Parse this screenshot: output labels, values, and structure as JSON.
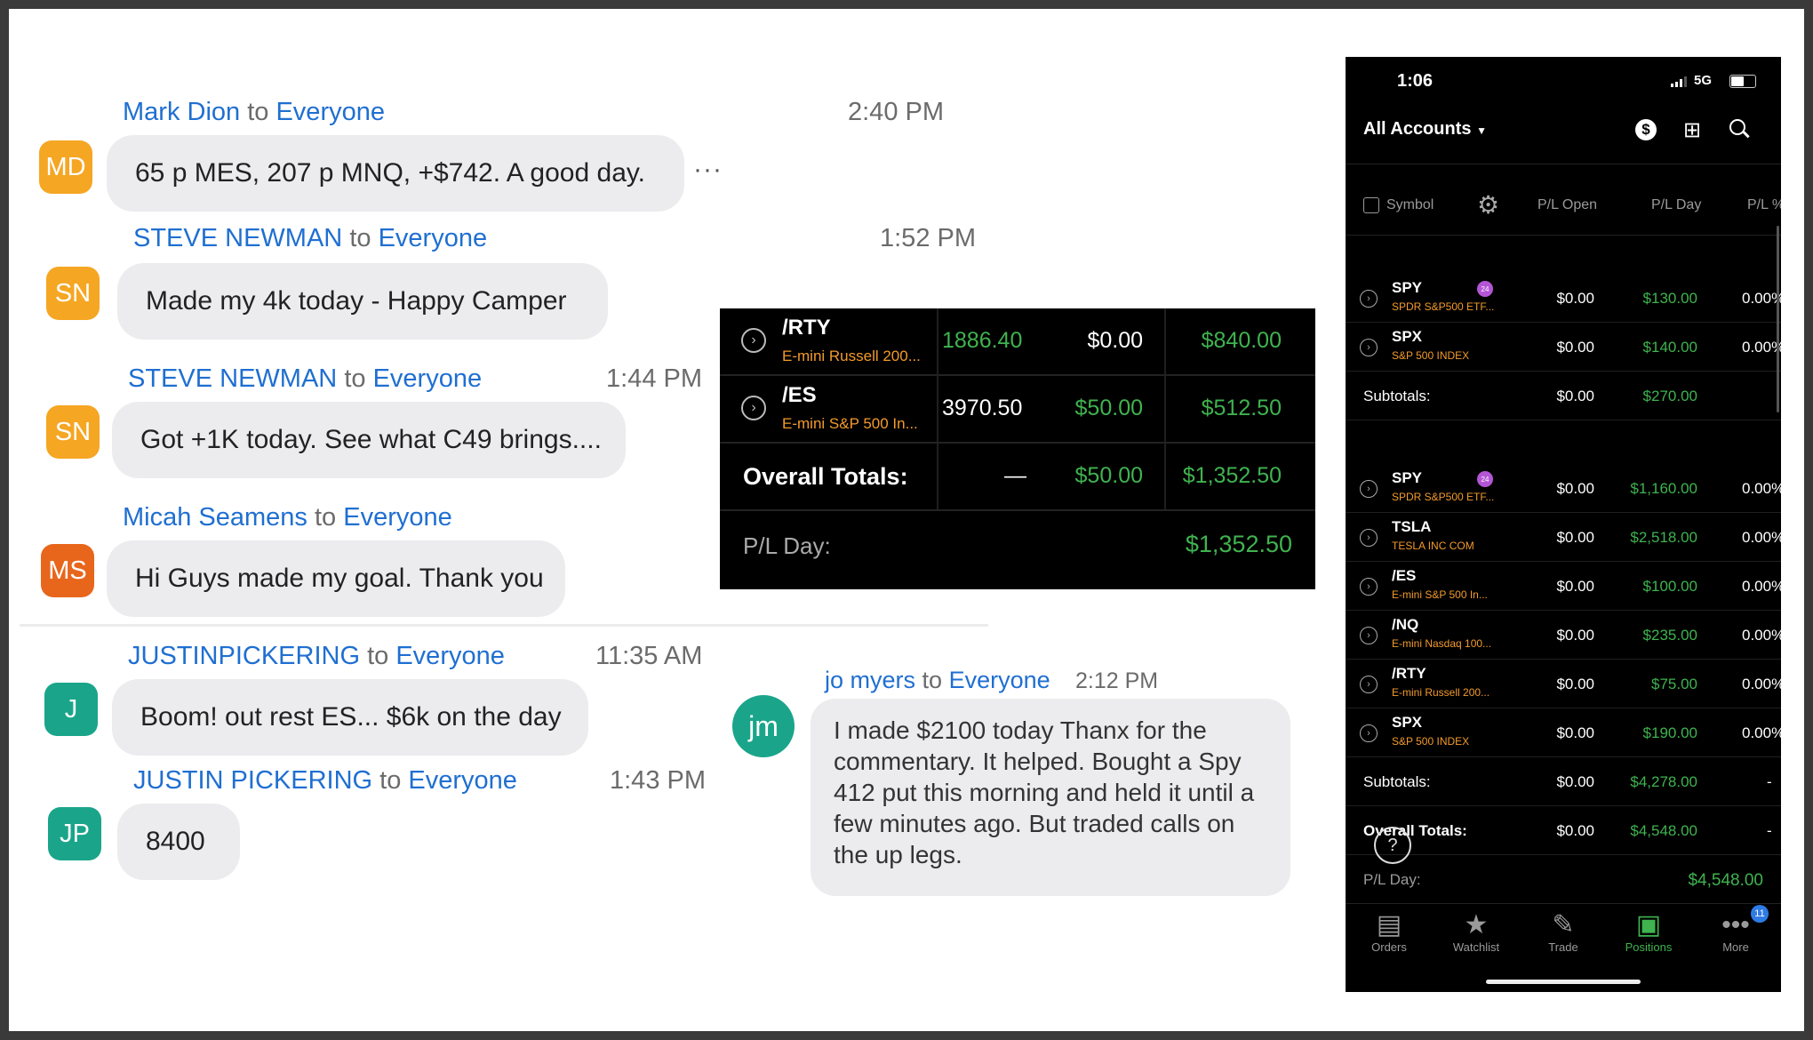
{
  "chat": [
    {
      "initials": "MD",
      "name": "Mark Dion",
      "to": "to",
      "audience": "Everyone",
      "time": "2:40 PM",
      "text": "65 p MES, 207 p MNQ, +$742.    A good day.",
      "color": "#f5a623"
    },
    {
      "initials": "SN",
      "name": "STEVE NEWMAN",
      "to": "to",
      "audience": "Everyone",
      "time": "1:52 PM",
      "text": "Made my 4k today - Happy Camper",
      "color": "#f5a623"
    },
    {
      "initials": "SN",
      "name": "STEVE NEWMAN",
      "to": "to",
      "audience": "Everyone",
      "time": "1:44 PM",
      "text": "Got +1K today. See what C49 brings....",
      "color": "#f5a623"
    },
    {
      "initials": "MS",
      "name": "Micah Seamens",
      "to": "to",
      "audience": "Everyone",
      "time": "",
      "text": "Hi Guys made my goal. Thank you",
      "color": "#e8661c"
    },
    {
      "initials": "J",
      "name": "JUSTINPICKERING",
      "to": "to",
      "audience": "Everyone",
      "time": "11:35 AM",
      "text": "Boom! out rest ES... $6k on the day",
      "color": "#1aa58a"
    },
    {
      "initials": "JP",
      "name": "JUSTIN PICKERING",
      "to": "to",
      "audience": "Everyone",
      "time": "1:43 PM",
      "text": "8400",
      "color": "#1aa58a"
    },
    {
      "initials": "jm",
      "name": "jo myers",
      "to": "to",
      "audience": "Everyone",
      "time": "2:12 PM",
      "text": "I made $2100 today Thanx for the commentary. It helped. Bought a Spy 412 put this morning and held it until a few minutes ago. But traded calls on the up legs.",
      "color": "#1aa58a"
    }
  ],
  "more_menu": "···",
  "futures_table": {
    "rows": [
      {
        "symbol": "/RTY",
        "desc": "E-mini Russell 200...",
        "price": "1886.40",
        "pl_open": "$0.00",
        "pl_day": "$840.00"
      },
      {
        "symbol": "/ES",
        "desc": "E-mini S&P 500 In...",
        "price": "3970.50",
        "pl_open": "$50.00",
        "pl_day": "$512.50"
      }
    ],
    "totals_label": "Overall Totals:",
    "totals_dash": "—",
    "totals_open": "$50.00",
    "totals_day": "$1,352.50",
    "pl_day_label": "P/L Day:",
    "pl_day_value": "$1,352.50"
  },
  "phone": {
    "time": "1:06",
    "network": "5G",
    "accounts": "All Accounts",
    "columns": {
      "symbol": "Symbol",
      "pl_open": "P/L Open",
      "pl_day": "P/L Day",
      "pl_pct": "P/L %"
    },
    "group1": [
      {
        "symbol": "SPY",
        "desc": "SPDR S&P500 ETF...",
        "pl_open": "$0.00",
        "pl_day": "$130.00",
        "pct": "0.00%",
        "badge": "24"
      },
      {
        "symbol": "SPX",
        "desc": "S&P 500 INDEX",
        "pl_open": "$0.00",
        "pl_day": "$140.00",
        "pct": "0.00%",
        "badge": ""
      }
    ],
    "sub1": {
      "label": "Subtotals:",
      "pl_open": "$0.00",
      "pl_day": "$270.00"
    },
    "group2": [
      {
        "symbol": "SPY",
        "desc": "SPDR S&P500 ETF...",
        "pl_open": "$0.00",
        "pl_day": "$1,160.00",
        "pct": "0.00%",
        "badge": "24"
      },
      {
        "symbol": "TSLA",
        "desc": "TESLA INC COM",
        "pl_open": "$0.00",
        "pl_day": "$2,518.00",
        "pct": "0.00%",
        "badge": ""
      },
      {
        "symbol": "/ES",
        "desc": "E-mini S&P 500 In...",
        "pl_open": "$0.00",
        "pl_day": "$100.00",
        "pct": "0.00%",
        "badge": ""
      },
      {
        "symbol": "/NQ",
        "desc": "E-mini Nasdaq 100...",
        "pl_open": "$0.00",
        "pl_day": "$235.00",
        "pct": "0.00%",
        "badge": ""
      },
      {
        "symbol": "/RTY",
        "desc": "E-mini Russell 200...",
        "pl_open": "$0.00",
        "pl_day": "$75.00",
        "pct": "0.00%",
        "badge": ""
      },
      {
        "symbol": "SPX",
        "desc": "S&P 500 INDEX",
        "pl_open": "$0.00",
        "pl_day": "$190.00",
        "pct": "0.00%",
        "badge": ""
      }
    ],
    "sub2": {
      "label": "Subtotals:",
      "pl_open": "$0.00",
      "pl_day": "$4,278.00",
      "pct": "-"
    },
    "overall": {
      "label": "Overall Totals:",
      "pl_open": "$0.00",
      "pl_day": "$4,548.00",
      "pct": "-"
    },
    "pl_day": {
      "label": "P/L Day:",
      "value": "$4,548.00"
    },
    "help": "?",
    "tabs": [
      {
        "label": "Orders",
        "icon": "orders-icon"
      },
      {
        "label": "Watchlist",
        "icon": "watchlist-icon"
      },
      {
        "label": "Trade",
        "icon": "trade-icon"
      },
      {
        "label": "Positions",
        "icon": "positions-icon"
      },
      {
        "label": "More",
        "icon": "more-icon",
        "badge": "11"
      }
    ],
    "accent": "#3fb34f"
  }
}
